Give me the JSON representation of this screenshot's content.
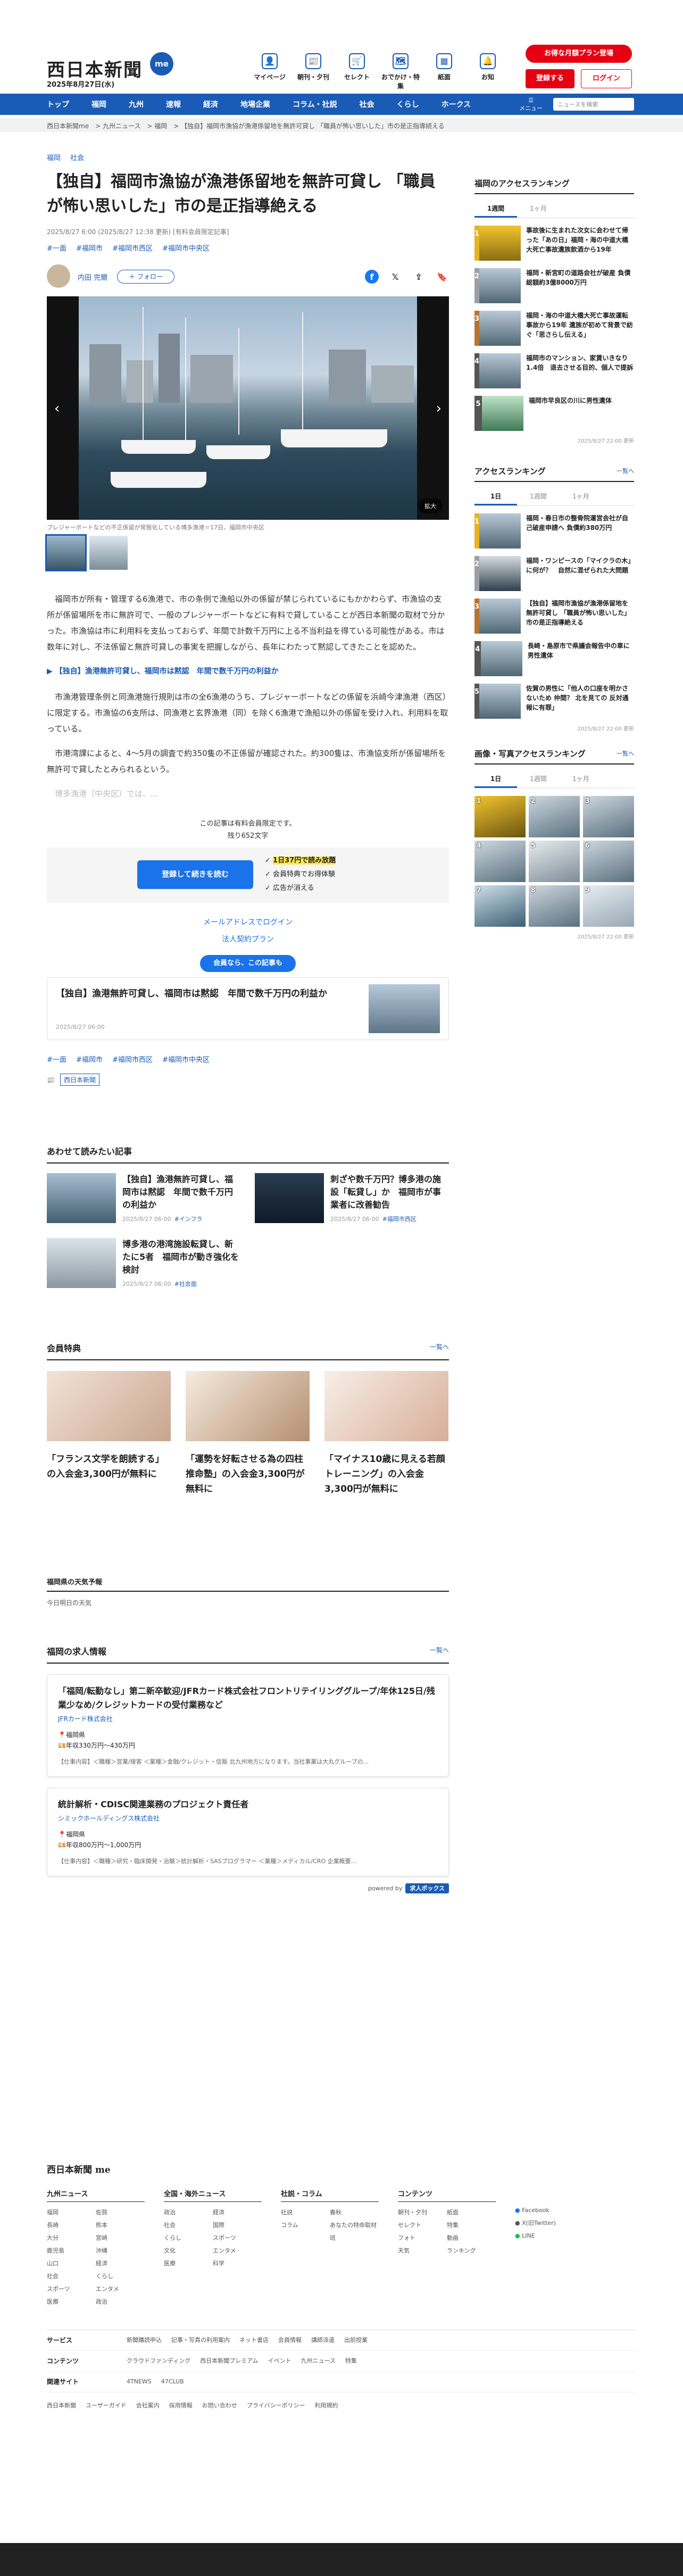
{
  "header": {
    "logo": "西日本新聞",
    "badge": "me",
    "date": "2025年8月27日(水)",
    "icons": [
      {
        "label": "マイページ",
        "glyph": "👤"
      },
      {
        "label": "朝刊・夕刊",
        "glyph": "📰"
      },
      {
        "label": "セレクト",
        "glyph": "🛒"
      },
      {
        "label": "おでかけ・特集",
        "glyph": "🗺"
      },
      {
        "label": "紙面",
        "glyph": "▦"
      },
      {
        "label": "お知",
        "glyph": "🔔"
      }
    ],
    "promo": "お得な月額プラン登場",
    "register": "登録する",
    "login": "ログイン"
  },
  "nav": {
    "items": [
      "トップ",
      "福岡",
      "九州",
      "速報",
      "経済",
      "地場企業",
      "コラム・社説",
      "社会",
      "くらし",
      "ホークス"
    ],
    "more": "メニュー",
    "search_placeholder": "ニュースを検索"
  },
  "breadcrumb": [
    "西日本新聞me",
    "九州ニュース",
    "福岡",
    "【独自】福岡市漁協が漁港係留地を無許可貸し 「職員が怖い思いした」市の是正指導続える"
  ],
  "article": {
    "categories": [
      "福岡",
      "社会"
    ],
    "headline": "【独自】福岡市漁協が漁港係留地を無許可貸し 「職員が怖い思いした」市の是正指導絶える",
    "pubdate": "2025/8/27 6:00 (2025/8/27 12:38 更新) [有料会員限定記事]",
    "tags": [
      "#一面",
      "#福岡市",
      "#福岡市西区",
      "#福岡市中央区"
    ],
    "author": "内田 完爾",
    "follow": "＋ フォロー",
    "photo_zoom": "拡大",
    "caption": "プレジャーボートなどの不正係留が常態化している博多漁港＝17日、福岡市中央区",
    "paragraphs": [
      "福岡市が所有・管理する6漁港で、市の条例で漁船以外の係留が禁じられているにもかかわらず、市漁協の支所が係留場所を市に無許可で、一般のプレジャーボートなどに有料で貸していることが西日本新聞の取材で分かった。市漁協は市に利用料を支払っておらず、年間で計数千万円に上る不当利益を得ている可能性がある。市は数年に対し、不法係留と無許可貸しの事実を把握しながら、長年にわたって黙認してきたことを認めた。",
      "市漁港管理条例と同漁港施行規則は市の全6漁港のうち、プレジャーボートなどの係留を浜崎今津漁港（西区）に限定する。市漁協の6支所は、同漁港と玄界漁港（同）を除く6漁港で漁船以外の係留を受け入れ、利用料を取っている。",
      "市港湾課によると、4〜5月の調査で約350隻の不正係留が確認された。約300隻は、市漁協支所が係留場所を無許可で貸したとみられるという。"
    ],
    "inline_related": "▶ 【独自】漁港無許可貸し、福岡市は黙認　年間で数千万円の利益か",
    "faded": "博多漁港（中央区）では、...",
    "paywall_title": "この記事は有料会員限定です。",
    "paywall_remain": "残り652文字",
    "paywall_button": "登録して続きを読む",
    "paywall_benefits": [
      "1日37円で読み放題",
      "会員特典でお得体験",
      "広告が消える"
    ],
    "login_link": "メールアドレスでログイン",
    "corp_link": "法人契約プラン",
    "popular_label": "会員なら、この記事も",
    "popular_title": "【独自】漁港無許可貸し、福岡市は黙認　年間で数千万円の利益か",
    "popular_date": "2025/8/27 06:00",
    "tags_bottom": [
      "#一面",
      "#福岡市",
      "#福岡市西区",
      "#福岡市中央区"
    ],
    "source": "西日本新聞"
  },
  "related": {
    "title": "あわせて読みたい記事",
    "items": [
      {
        "title": "【独自】漁港無許可貸し、福岡市は黙認　年間で数千万円の利益か",
        "date": "2025/8/27 06:00",
        "cat": "#インフラ"
      },
      {
        "title": "刺ざや数千万円？博多港の施設「転貸し」か　福岡市が事業者に改善勧告",
        "date": "2025/8/27 06:00",
        "cat": "#福岡市西区"
      },
      {
        "title": "博多港の港湾施設転貸し、新たに5者　福岡市が動き強化を検討",
        "date": "2025/8/27 06:00",
        "cat": "#社会面"
      }
    ]
  },
  "member": {
    "title": "会員特典",
    "more": "一覧へ",
    "items": [
      "「フランス文学を朗読する」の入会金3,300円が無料に",
      "「運勢を好転させる為の四柱推命塾」の入会金3,300円が無料に",
      "「マイナス10歳に見える若顔トレーニング」の入会金3,300円が無料に"
    ]
  },
  "weather": {
    "title": "福岡県の天気予報",
    "body": "今日明日の天気"
  },
  "jobs": {
    "title": "福岡の求人情報",
    "more": "一覧へ",
    "items": [
      {
        "title": "「福岡/転勤なし」第二新卒歓迎/JFRカード株式会社フロントリテイリンググループ/年休125日/残業少なめ/クレジットカードの受付業務など",
        "company": "JFRカード株式会社",
        "meta": [
          "福岡県",
          "年収330万円〜430万円"
        ],
        "desc": "【仕事内容】＜職種＞営業/接客 ＜業種＞金融/クレジット・信販 北九州地方になります。当社事業は大丸グループの..."
      },
      {
        "title": "統計解析・CDISC関連業務のプロジェクト責任者",
        "company": "シミックホールディングス株式会社",
        "meta": [
          "福岡県",
          "年収800万円〜1,000万円"
        ],
        "desc": "【仕事内容】＜職種＞研究・臨床開発・治験＞統計解析・SASプログラマー ＜業種＞メディカル/CRO 企業概要..."
      }
    ],
    "powered": "powered by",
    "brand": "求人ボックス"
  },
  "sidebar": {
    "fukuoka_rank": {
      "title": "福岡のアクセスランキング",
      "tabs": [
        "1週間",
        "1ヶ月"
      ],
      "items": [
        "事故後に生まれた次女に会わせて帰った「あの日」福岡・海の中道大橋大死亡事故遺族飲酒から19年",
        "福岡・新宮町の道路会社が破産 負債総額約3億8000万円",
        "福岡・海の中道大橋大死亡事故運転事故から19年 遺族が初めて背景で紡ぐ「思さらし伝える」",
        "福岡市のマンション、家賃いきなり1.4倍　退去させる目的、個人で提訴",
        "福岡市早良区の川に男性遺体"
      ],
      "date": "2025/8/27 22:00 更新"
    },
    "access_rank": {
      "title": "アクセスランキング",
      "more": "一覧へ",
      "tabs": [
        "1日",
        "1週間",
        "1ヶ月"
      ],
      "items": [
        "福岡・春日市の整骨院運営会社が自己破産申請へ 負債約380万円",
        "福岡・ワンピースの「マイクラの木」に何が？　自然に混ぜられた大問題",
        "【独自】福岡市漁協が漁港係留地を無許可貸し 「職員が怖い思いした」市の是正指導絶える",
        "長崎・島原市で県議会報告中の車に男性遺体",
        "佐賀の男性に「他人の口座を明かさないため 仲間？ 北を見ての 反対通報に有罪」"
      ],
      "date": "2025/8/27 22:00 更新"
    },
    "photo_rank": {
      "title": "画像・写真アクセスランキング",
      "more": "一覧へ",
      "tabs": [
        "1日",
        "1週間",
        "1ヶ月"
      ],
      "date": "2025/8/27 22:00 更新"
    }
  },
  "footer": {
    "logo": "西日本新聞 me",
    "cols": [
      {
        "title": "九州ニュース",
        "items": [
          "福岡",
          "佐賀",
          "長崎",
          "熊本",
          "大分",
          "宮崎",
          "鹿児島",
          "沖縄",
          "山口",
          "経済",
          "社会",
          "くらし",
          "スポーツ",
          "エンタメ",
          "医療",
          "政治"
        ]
      },
      {
        "title": "全国・海外ニュース",
        "items": [
          "政治",
          "経済",
          "社会",
          "国際",
          "くらし",
          "スポーツ",
          "文化",
          "エンタメ",
          "医療",
          "科学"
        ]
      },
      {
        "title": "社説・コラム",
        "items": [
          "社説",
          "春秋",
          "コラム",
          "あなたの特命取材班"
        ]
      },
      {
        "title": "コンテンツ",
        "items": [
          "朝刊・夕刊",
          "紙面",
          "セレクト",
          "特集",
          "フォト",
          "動画",
          "天気",
          "ランキング"
        ]
      }
    ],
    "social": [
      "Facebook",
      "X(旧Twitter)",
      "LINE"
    ],
    "rows": [
      {
        "label": "サービス",
        "links": [
          "新聞購読申込",
          "記事・写真の利用案内",
          "ネット書店",
          "会員情報",
          "講師派遣",
          "出前授業"
        ]
      },
      {
        "label": "コンテンツ",
        "links": [
          "クラウドファンディング",
          "西日本新聞プレミアム",
          "イベント",
          "九州ニュース",
          "特集"
        ]
      },
      {
        "label": "関連サイト",
        "links": [
          "4TNEWS",
          "47CLUB"
        ]
      }
    ],
    "copy": [
      "西日本新聞",
      "ユーザーガイド",
      "会社案内",
      "採用情報",
      "お問い合わせ",
      "プライバシーポリシー",
      "利用規約"
    ]
  }
}
